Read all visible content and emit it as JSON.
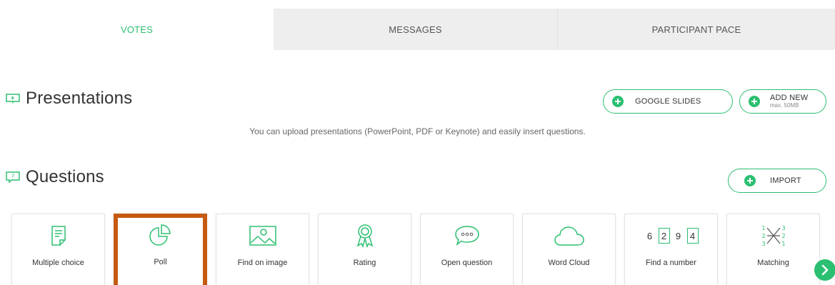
{
  "tabs": [
    {
      "label": "VOTES",
      "active": true
    },
    {
      "label": "MESSAGES",
      "active": false
    },
    {
      "label": "PARTICIPANT PACE",
      "active": false
    }
  ],
  "presentations": {
    "title": "Presentations",
    "google_slides_label": "GOOGLE SLIDES",
    "add_new_label": "ADD NEW",
    "add_new_sub": "max. 50MB",
    "hint": "You can upload presentations (PowerPoint, PDF or Keynote) and easily insert questions."
  },
  "questions": {
    "title": "Questions",
    "import_label": "IMPORT",
    "types": [
      {
        "label": "Multiple choice",
        "icon": "document-icon"
      },
      {
        "label": "Poll",
        "icon": "pie-chart-icon",
        "selected": true
      },
      {
        "label": "Find on image",
        "icon": "image-icon"
      },
      {
        "label": "Rating",
        "icon": "award-ribbon-icon"
      },
      {
        "label": "Open question",
        "icon": "speech-bubble-icon"
      },
      {
        "label": "Word Cloud",
        "icon": "cloud-icon"
      },
      {
        "label": "Find a number",
        "icon": "number-boxes-icon",
        "digits": [
          "6",
          "2",
          "9",
          "4"
        ]
      },
      {
        "label": "Matching",
        "icon": "matching-icon",
        "left": [
          "1",
          "2",
          "3"
        ],
        "right": [
          "3",
          "2",
          "1"
        ]
      }
    ]
  },
  "colors": {
    "accent": "#2bbf71",
    "selection": "#c55a11",
    "tab_inactive": "#eeeeee"
  }
}
